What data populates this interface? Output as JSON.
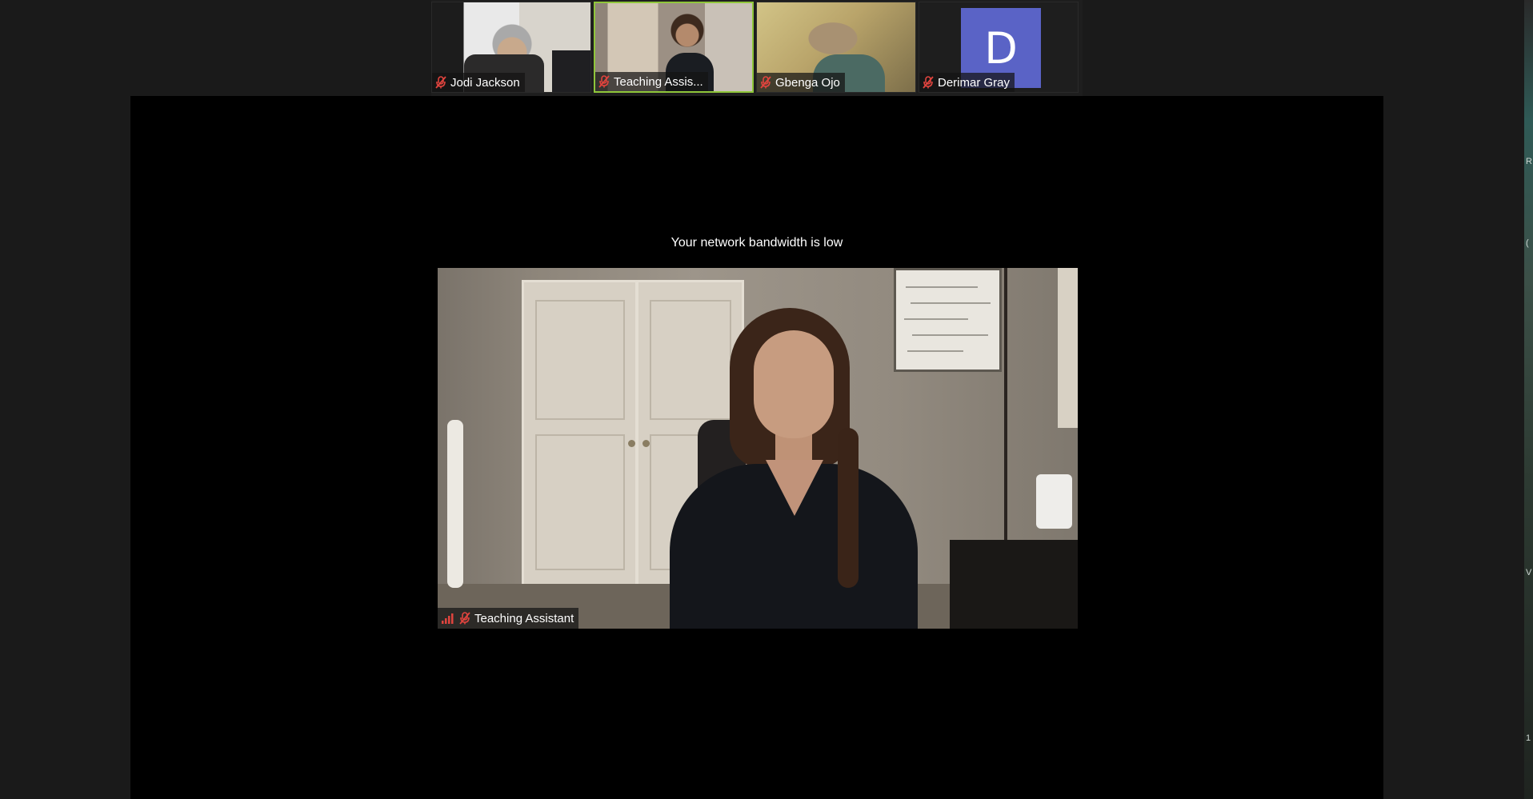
{
  "thumbnails": [
    {
      "name": "Jodi Jackson",
      "muted": true,
      "active": false
    },
    {
      "name": "Teaching Assis...",
      "muted": true,
      "active": true
    },
    {
      "name": "Gbenga Ojo",
      "muted": true,
      "active": false
    },
    {
      "name": "Derimar Gray",
      "muted": true,
      "active": false,
      "avatar_letter": "D",
      "avatar_color": "#5a63c6"
    }
  ],
  "stage": {
    "notice": "Your network bandwidth is low",
    "speaker_name": "Teaching Assistant",
    "speaker_muted": true,
    "signal_icon": "signal-bars-icon"
  },
  "colors": {
    "active_border": "#8fc63a",
    "muted_icon": "#e0443e",
    "signal": "#e0443e",
    "background": "#1a1a1a",
    "stage": "#000000"
  },
  "right_strip_fragments": [
    "R",
    "(",
    "V",
    "1"
  ]
}
